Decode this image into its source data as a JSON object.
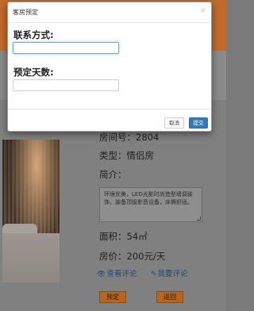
{
  "room": {
    "number_line": "房间号：2804",
    "type_line": "类型：情侣房",
    "intro_label": "简介：",
    "description": "环境优美，LED光影时尚造型墙调装饰，装备顶级影音设备，床褥舒适。",
    "area_line": "面积：54㎡",
    "price_line": "房价：200元/天"
  },
  "actions": {
    "view_reviews": "查看评论",
    "write_review": "我要评论",
    "book_button": "预定",
    "back_button": "返回"
  },
  "icons": {
    "view_reviews": "eye-icon",
    "write_review": "edit-icon",
    "close": "close-icon"
  },
  "modal": {
    "title": "客房预定",
    "close_symbol": "×",
    "contact_label": "联系方式:",
    "contact_value": "",
    "days_label": "预定天数:",
    "days_value": "",
    "cancel_button": "取消",
    "submit_button": "提交"
  },
  "colors": {
    "header_orange": "#c06a2b",
    "primary_blue": "#337ab7",
    "focus_blue": "#66afe9",
    "link_blue": "#1d4c7a"
  }
}
